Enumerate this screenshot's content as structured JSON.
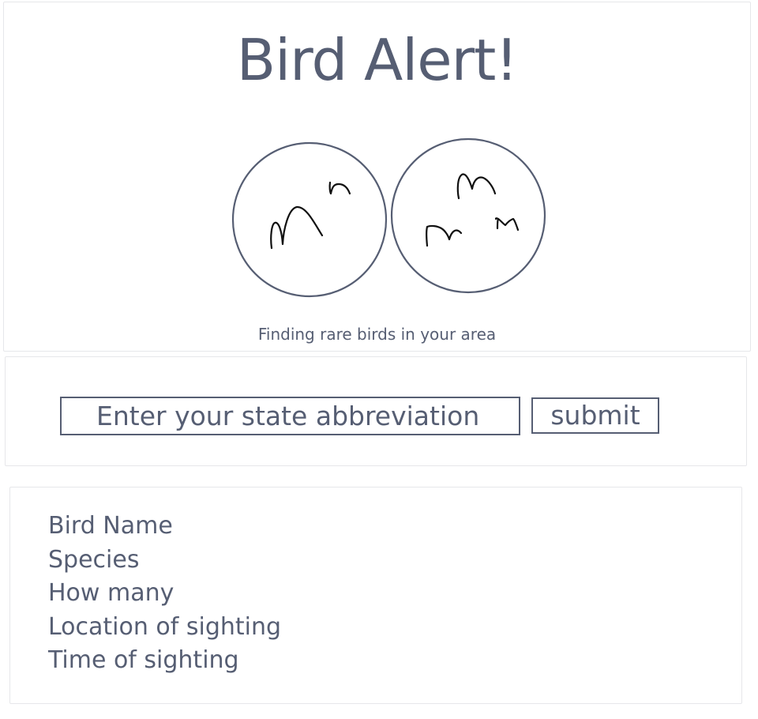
{
  "header": {
    "title": "Bird Alert!",
    "tagline": "Finding rare birds in your area",
    "logo_icon": "birds-in-circles-icon"
  },
  "search": {
    "placeholder": "Enter your state abbreviation",
    "value": "",
    "submit_label": "submit"
  },
  "results": {
    "fields": [
      "Bird Name",
      "Species",
      "How many",
      "Location of sighting",
      "Time of sighting"
    ]
  },
  "colors": {
    "text": "#565e73",
    "border": "#565e73",
    "panel_border": "#e6e7ea",
    "sketch": "#111111",
    "background": "#ffffff"
  }
}
